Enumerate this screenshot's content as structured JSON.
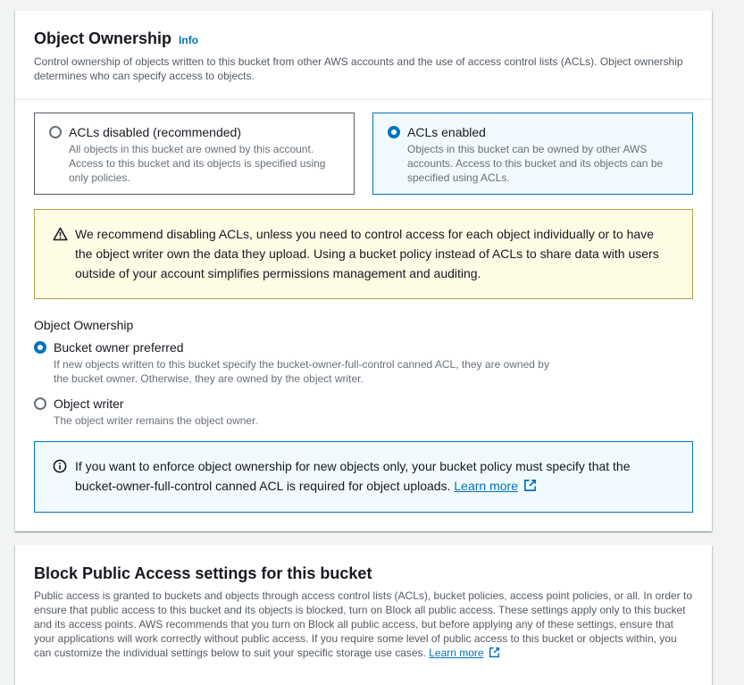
{
  "ownership": {
    "title": "Object Ownership",
    "info_label": "Info",
    "description": "Control ownership of objects written to this bucket from other AWS accounts and the use of access control lists (ACLs). Object ownership determines who can specify access to objects.",
    "tiles": [
      {
        "label": "ACLs disabled (recommended)",
        "description": "All objects in this bucket are owned by this account. Access to this bucket and its objects is specified using only policies.",
        "selected": false
      },
      {
        "label": "ACLs enabled",
        "description": "Objects in this bucket can be owned by other AWS accounts. Access to this bucket and its objects can be specified using ACLs.",
        "selected": true
      }
    ],
    "warning_text": "We recommend disabling ACLs, unless you need to control access for each object individually or to have the object writer own the data they upload. Using a bucket policy instead of ACLs to share data with users outside of your account simplifies permissions management and auditing.",
    "group_label": "Object Ownership",
    "options": [
      {
        "label": "Bucket owner preferred",
        "description": "If new objects written to this bucket specify the bucket-owner-full-control canned ACL, they are owned by the bucket owner. Otherwise, they are owned by the object writer.",
        "selected": true
      },
      {
        "label": "Object writer",
        "description": "The object writer remains the object owner.",
        "selected": false
      }
    ],
    "info_text": "If you want to enforce object ownership for new objects only, your bucket policy must specify that the bucket-owner-full-control canned ACL is required for object uploads.",
    "info_link": "Learn more"
  },
  "bpa": {
    "title": "Block Public Access settings for this bucket",
    "description": "Public access is granted to buckets and objects through access control lists (ACLs), bucket policies, access point policies, or all. In order to ensure that public access to this bucket and its objects is blocked, turn on Block all public access. These settings apply only to this bucket and its access points. AWS recommends that you turn on Block all public access, but before applying any of these settings, ensure that your applications will work correctly without public access. If you require some level of public access to this bucket or objects within, you can customize the individual settings below to suit your specific storage use cases.",
    "link": "Learn more"
  },
  "icons": {
    "warning": "warning-icon",
    "info": "info-circle-icon",
    "external": "external-link-icon"
  },
  "colors": {
    "accent": "#0073bb",
    "warning_bg": "#fffce6",
    "info_bg": "#f1faff"
  }
}
